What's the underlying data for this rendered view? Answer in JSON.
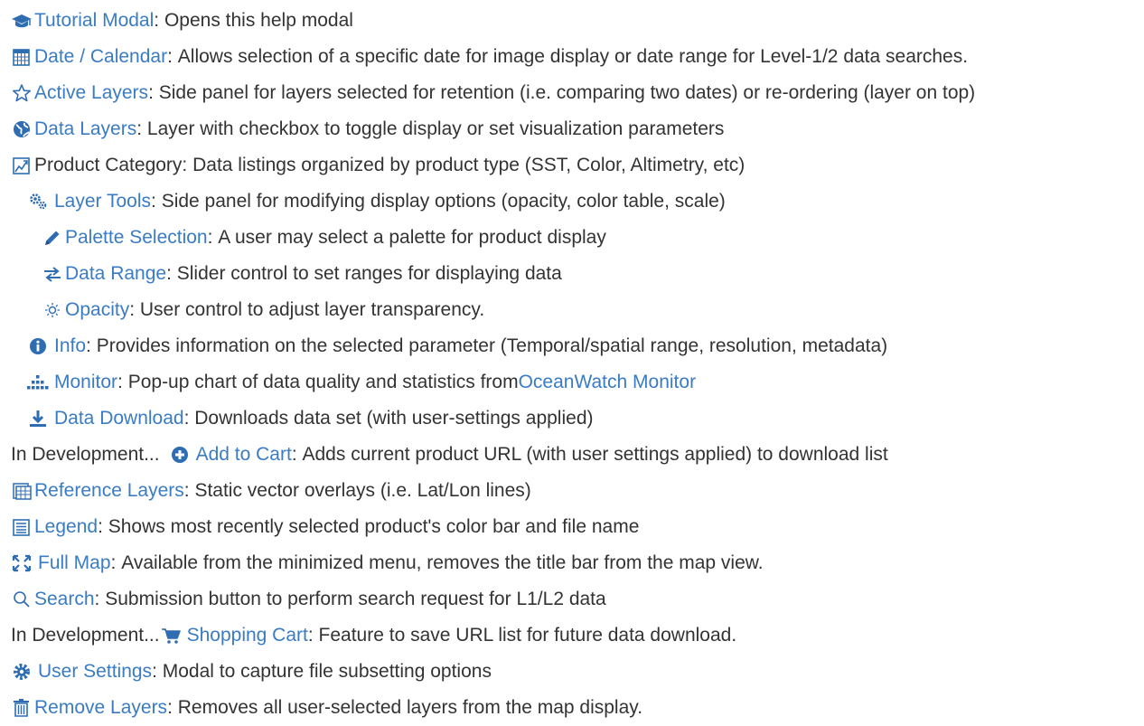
{
  "colors": {
    "link": "#3a7cc4",
    "text": "#333333",
    "icon": "#2f6db3"
  },
  "items": [
    {
      "icon": "graduation-cap-icon",
      "label": "Tutorial Modal",
      "desc": "Opens this help modal"
    },
    {
      "icon": "calendar-icon",
      "label": "Date / Calendar",
      "desc": "Allows selection of a specific date for image display or date range for Level-1/2 data searches."
    },
    {
      "icon": "star-icon",
      "label": "Active Layers",
      "desc": "Side panel for layers selected for retention (i.e. comparing two dates) or re-ordering (layer on top)"
    },
    {
      "icon": "globe-icon",
      "label": "Data Layers",
      "desc": "Layer with checkbox to toggle display or set visualization parameters"
    },
    {
      "icon": "category-icon",
      "label": "Product Category",
      "desc": "Data listings organized by product type (SST, Color, Altimetry, etc)"
    },
    {
      "icon": "gears-icon",
      "label": "Layer Tools",
      "desc": "Side panel for modifying display options (opacity, color table, scale)"
    },
    {
      "icon": "pencil-icon",
      "label": "Palette Selection",
      "desc": "A user may select a palette for product display"
    },
    {
      "icon": "arrows-icon",
      "label": "Data Range",
      "desc": "Slider control to set ranges for displaying data"
    },
    {
      "icon": "brightness-icon",
      "label": "Opacity",
      "desc": "User control to adjust layer transparency."
    },
    {
      "icon": "info-icon",
      "label": "Info",
      "desc": "Provides information on the selected parameter (Temporal/spatial range, resolution, metadata)"
    },
    {
      "icon": "monitor-chart-icon",
      "label": "Monitor",
      "desc": "Pop-up chart of data quality and statistics from ",
      "link2": "OceanWatch Monitor"
    },
    {
      "icon": "download-icon",
      "label": "Data Download",
      "desc": "Downloads data set (with user-settings applied)"
    },
    {
      "prefix": "In Development...",
      "icon": "plus-circle-icon",
      "label": "Add to Cart",
      "desc": "Adds current product URL (with user settings applied) to download list"
    },
    {
      "icon": "reference-layers-icon",
      "label": "Reference Layers",
      "desc": "Static vector overlays (i.e. Lat/Lon lines)"
    },
    {
      "icon": "legend-icon",
      "label": "Legend",
      "desc": "Shows most recently selected product's color bar and file name"
    },
    {
      "icon": "fullscreen-icon",
      "label": "Full Map",
      "desc": "Available from the minimized menu, removes the title bar from the map view."
    },
    {
      "icon": "search-icon",
      "label": "Search",
      "desc": "Submission button to perform search request for L1/L2 data"
    },
    {
      "prefix": "In Development...",
      "icon": "shopping-cart-icon",
      "label": "Shopping Cart",
      "desc": "Feature to save URL list for future data download."
    },
    {
      "icon": "cog-icon",
      "label": "User Settings",
      "desc": "Modal to capture file subsetting options"
    },
    {
      "icon": "trash-icon",
      "label": "Remove Layers",
      "desc": "Removes all user-selected layers from the map display."
    }
  ]
}
